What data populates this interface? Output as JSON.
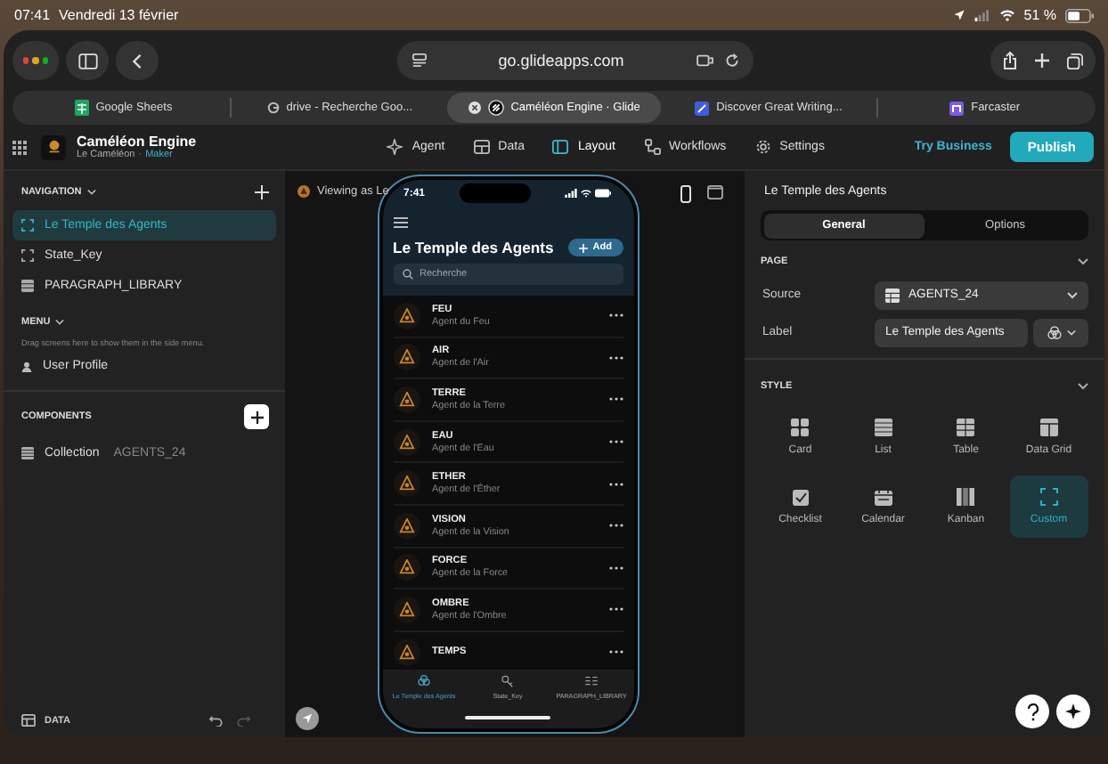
{
  "status_bar": {
    "time": "07:41",
    "date": "Vendredi 13 février",
    "battery": "51 %"
  },
  "browser": {
    "url": "go.glideapps.com",
    "tabs": [
      {
        "title": "Google Sheets",
        "kind": "sheets",
        "selected": false
      },
      {
        "title": "drive - Recherche Goo...",
        "kind": "search",
        "selected": false
      },
      {
        "title": "Caméléon Engine · Glide",
        "kind": "glide",
        "selected": true
      },
      {
        "title": "Discover Great Writing...",
        "kind": "writing",
        "selected": false
      },
      {
        "title": "Farcaster",
        "kind": "farcaster",
        "selected": false
      }
    ]
  },
  "app_header": {
    "app_name": "Caméléon Engine",
    "owner": "Le Caméléon",
    "separator": "·",
    "role": "Maker",
    "nav": [
      {
        "label": "Agent",
        "kind": "agent",
        "selected": false
      },
      {
        "label": "Data",
        "kind": "data",
        "selected": false
      },
      {
        "label": "Layout",
        "kind": "layout",
        "selected": true
      },
      {
        "label": "Workflows",
        "kind": "workflows",
        "selected": false
      },
      {
        "label": "Settings",
        "kind": "settings",
        "selected": false
      }
    ],
    "try_business": "Try Business",
    "publish": "Publish"
  },
  "sidebar": {
    "navigation_heading": "NAVIGATION",
    "screens": [
      {
        "label": "Le Temple des Agents",
        "kind": "screen",
        "selected": true
      },
      {
        "label": "State_Key",
        "kind": "screen",
        "selected": false
      },
      {
        "label": "PARAGRAPH_LIBRARY",
        "kind": "table",
        "selected": false
      }
    ],
    "menu_heading": "MENU",
    "menu_hint": "Drag screens here to show them in the side menu.",
    "menu_items": [
      "User Profile"
    ],
    "components_heading": "COMPONENTS",
    "components": [
      {
        "label": "Collection",
        "source": "AGENTS_24"
      }
    ],
    "data_button": "DATA"
  },
  "canvas": {
    "viewing_as": "Viewing as Le",
    "phone": {
      "time": "7:41",
      "title": "Le Temple des Agents",
      "add_button": "Add",
      "search_placeholder": "Recherche",
      "agents": [
        {
          "name": "FEU",
          "subtitle": "Agent du Feu"
        },
        {
          "name": "AIR",
          "subtitle": "Agent de l'Air"
        },
        {
          "name": "TERRE",
          "subtitle": "Agent de la Terre"
        },
        {
          "name": "EAU",
          "subtitle": "Agent de l'Eau"
        },
        {
          "name": "ETHER",
          "subtitle": "Agent de l'Éther"
        },
        {
          "name": "VISION",
          "subtitle": "Agent de la Vision"
        },
        {
          "name": "FORCE",
          "subtitle": "Agent de la Force"
        },
        {
          "name": "OMBRE",
          "subtitle": "Agent de l'Ombre"
        },
        {
          "name": "TEMPS"
        }
      ],
      "tab_bar": [
        {
          "label": "Le Temple des Agents",
          "kind": "temple",
          "selected": true
        },
        {
          "label": "State_Key",
          "kind": "key",
          "selected": false
        },
        {
          "label": "PARAGRAPH_LIBRARY",
          "kind": "library",
          "selected": false
        }
      ]
    }
  },
  "properties": {
    "title": "Le Temple des Agents",
    "tabs": [
      {
        "label": "General",
        "selected": true
      },
      {
        "label": "Options",
        "selected": false
      }
    ],
    "page_heading": "PAGE",
    "source_label": "Source",
    "source_value": "AGENTS_24",
    "label_label": "Label",
    "label_value": "Le Temple des Agents",
    "style_heading": "STYLE",
    "styles": [
      {
        "label": "Card",
        "kind": "card",
        "selected": false
      },
      {
        "label": "List",
        "kind": "list",
        "selected": false
      },
      {
        "label": "Table",
        "kind": "table",
        "selected": false
      },
      {
        "label": "Data Grid",
        "kind": "grid",
        "selected": false
      },
      {
        "label": "Checklist",
        "kind": "checklist",
        "selected": false
      },
      {
        "label": "Calendar",
        "kind": "calendar",
        "selected": false
      },
      {
        "label": "Kanban",
        "kind": "kanban",
        "selected": false
      },
      {
        "label": "Custom",
        "kind": "custom",
        "selected": true
      }
    ]
  }
}
